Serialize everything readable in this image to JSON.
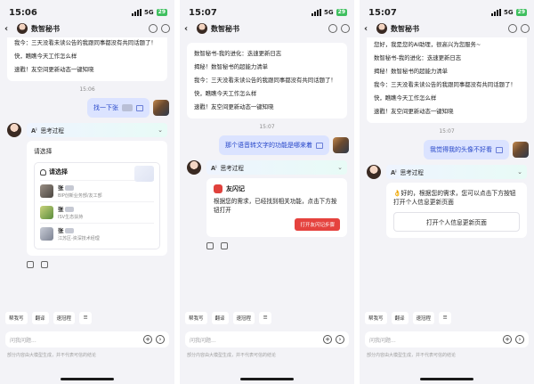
{
  "colors": {
    "accent": "#2747c9",
    "user_bubble": "#dbe3ff",
    "red_button": "#e5423e",
    "battery": "#3fbf5f"
  },
  "phones": [
    {
      "status": {
        "time": "15:06",
        "network": "5G",
        "battery": "29"
      },
      "header": {
        "title": "数智秘书"
      },
      "top_card": {
        "lines": [
          "我今：三天没看未读公告的我跟同事都没有共同话题了！",
          "快，瞧瞧今天工作怎么样",
          "速戳！友空间更新动态一键知晓"
        ]
      },
      "timestamp": "15:06",
      "user_message": "找一下张",
      "thinking_label": "思考过程",
      "ai_reply": "请选择",
      "picker": {
        "title": "请选择",
        "people": [
          {
            "name": "张",
            "desc": "BIP创新业务部/友工部"
          },
          {
            "name": "张",
            "desc": "ISV生态扶持"
          },
          {
            "name": "张",
            "desc": "江苏区-资深技术经理"
          }
        ]
      },
      "chips": [
        "帮我写",
        "翻译",
        "速冠程"
      ],
      "input_placeholder": "问我问题...",
      "disclaimer": "部分内容由大模型生成，并不代表可信的结论"
    },
    {
      "status": {
        "time": "15:07",
        "network": "5G",
        "battery": "29"
      },
      "header": {
        "title": "数智秘书"
      },
      "top_card": {
        "lines": [
          "数智秘书-我的进化：迭速更新日志",
          "揭秘！数智秘书的超能力清单",
          "我今：三天没看未读公告的我跟同事都没有共同话题了！",
          "快，瞧瞧今天工作怎么样",
          "速戳！友空间更新动态一键知晓"
        ]
      },
      "timestamp": "15:07",
      "user_message": "那个语音转文字的功能是哪来着",
      "thinking_label": "思考过程",
      "app": {
        "name": "友闪记",
        "text": "根据您的需求，已经找到相关功能，点击下方按钮打开",
        "button": "打开友闪记步骤"
      },
      "chips": [
        "帮我写",
        "翻译",
        "速冠程"
      ],
      "input_placeholder": "问我问题...",
      "disclaimer": "部分内容由大模型生成，并不代表可信的结论"
    },
    {
      "status": {
        "time": "15:07",
        "network": "5G",
        "battery": "29"
      },
      "header": {
        "title": "数智秘书"
      },
      "top_card": {
        "lines": [
          "您好，我是您的AI助理，很高兴为您服务~",
          "数智秘书-我的进化：迭速更新日志",
          "揭秘！数智秘书的超能力清单",
          "我今：三天没看未读公告的我跟同事都没有共同话题了！",
          "快，瞧瞧今天工作怎么样",
          "速戳！友空间更新动态一键知晓"
        ]
      },
      "timestamp": "15:07",
      "user_message": "我觉得我的头像不好看",
      "thinking_label": "思考过程",
      "answer": {
        "emoji": "👌",
        "text": "好的，根据您的需求，您可以点击下方按钮打开个人信息更新页面",
        "button": "打开个人信息更新页面"
      },
      "chips": [
        "帮我写",
        "翻译",
        "速冠程"
      ],
      "input_placeholder": "问我问题...",
      "disclaimer": "部分内容由大模型生成，并不代表可信的结论"
    }
  ]
}
